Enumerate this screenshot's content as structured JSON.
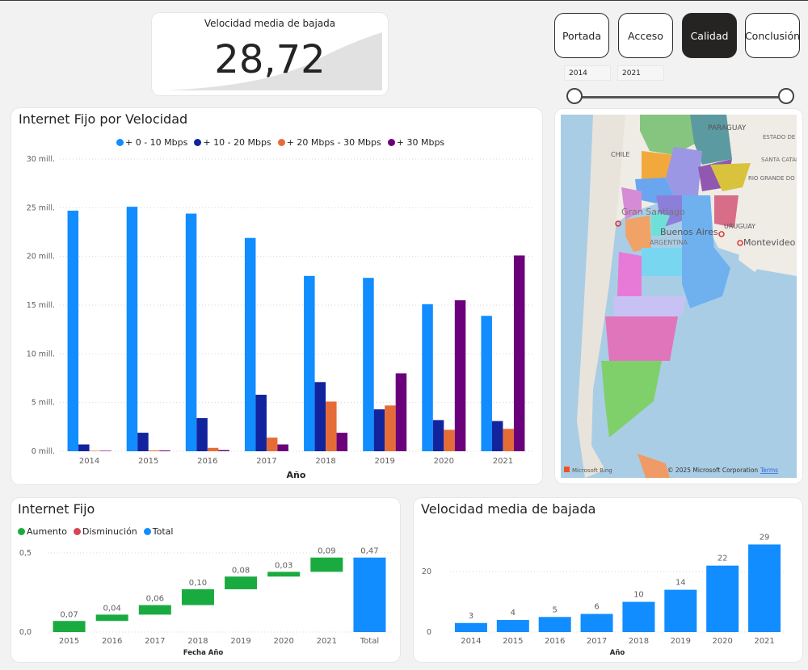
{
  "kpi": {
    "title": "Velocidad media de bajada",
    "value": "28,72"
  },
  "nav": {
    "buttons": [
      {
        "label": "Portada",
        "active": false
      },
      {
        "label": "Acceso",
        "active": false
      },
      {
        "label": "Calidad",
        "active": true
      },
      {
        "label": "Conclusión",
        "active": false
      }
    ]
  },
  "slicer": {
    "from": "2014",
    "to": "2021"
  },
  "chart1": {
    "title": "Internet Fijo por Velocidad",
    "xlabel": "Año",
    "yticks": [
      "0 mill.",
      "5 mill.",
      "10 mill.",
      "15 mill.",
      "20 mill.",
      "25 mill.",
      "30 mill."
    ],
    "legend": [
      "+ 0 - 10 Mbps",
      "+ 10 - 20 Mbps",
      "+ 20 Mbps - 30 Mbps",
      "+ 30 Mbps"
    ]
  },
  "chart2": {
    "title": "Internet Fijo",
    "xlabel": "Fecha Año",
    "yticks": [
      "0,0",
      "0,5"
    ],
    "legend": [
      "Aumento",
      "Disminución",
      "Total"
    ]
  },
  "chart3": {
    "title": "Velocidad media de bajada",
    "xlabel": "Año",
    "yticks": [
      "0",
      "20"
    ]
  },
  "map": {
    "labels": {
      "paraguay": "PARAGUAY",
      "chile": "CHILE",
      "gran_santiago": "Gran Santiago",
      "buenos_aires": "Buenos Aires",
      "argentina": "ARGENTINA",
      "uruguay": "URUGUAY",
      "montevideo": "Montevideo",
      "estado_parana": "ESTADO DE PARANÁ",
      "santa_catarina": "SANTA CATARINA",
      "rio_grande": "RIO GRANDE DO SUL",
      "bing": "Microsoft Bing",
      "copyright": "© 2025 Microsoft Corporation",
      "terms": "Terms"
    }
  },
  "chart_data": [
    {
      "type": "bar",
      "title": "Internet Fijo por Velocidad",
      "xlabel": "Año",
      "categories": [
        "2014",
        "2015",
        "2016",
        "2017",
        "2018",
        "2019",
        "2020",
        "2021"
      ],
      "ylim": [
        0,
        30000000
      ],
      "legend": "top",
      "grid": true,
      "series": [
        {
          "name": "+ 0 - 10 Mbps",
          "color": "#118DFF",
          "values": [
            24700000,
            25100000,
            24400000,
            21900000,
            18000000,
            17800000,
            15100000,
            13900000
          ]
        },
        {
          "name": "+ 10 - 20 Mbps",
          "color": "#12239E",
          "values": [
            700000,
            1900000,
            3400000,
            5800000,
            7100000,
            4300000,
            3200000,
            3100000
          ]
        },
        {
          "name": "+ 20 Mbps - 30 Mbps",
          "color": "#E66C37",
          "values": [
            50000,
            80000,
            350000,
            1400000,
            5100000,
            4700000,
            2200000,
            2300000
          ]
        },
        {
          "name": "+ 30 Mbps",
          "color": "#6B007B",
          "values": [
            50000,
            80000,
            120000,
            700000,
            1900000,
            8000000,
            15500000,
            20100000
          ]
        }
      ]
    },
    {
      "type": "bar",
      "subtype": "waterfall",
      "title": "Internet Fijo",
      "xlabel": "Fecha Año",
      "categories": [
        "2015",
        "2016",
        "2017",
        "2018",
        "2019",
        "2020",
        "2021",
        "Total"
      ],
      "values": [
        0.07,
        0.04,
        0.06,
        0.1,
        0.08,
        0.03,
        0.09,
        0.47
      ],
      "labels": [
        "0,07",
        "0,04",
        "0,06",
        "0,10",
        "0,08",
        "0,03",
        "0,09",
        "0,47"
      ],
      "colors": {
        "increase": "#1AAB40",
        "decrease": "#D64554",
        "total": "#118DFF"
      },
      "ylim": [
        0,
        0.55
      ]
    },
    {
      "type": "bar",
      "title": "Velocidad media de bajada",
      "xlabel": "Año",
      "categories": [
        "2014",
        "2015",
        "2016",
        "2017",
        "2018",
        "2019",
        "2020",
        "2021"
      ],
      "values": [
        3,
        4,
        5,
        6,
        10,
        14,
        22,
        29
      ],
      "labels": [
        "3",
        "4",
        "5",
        "6",
        "10",
        "14",
        "22",
        "29"
      ],
      "color": "#118DFF",
      "ylim": [
        0,
        31
      ]
    }
  ]
}
